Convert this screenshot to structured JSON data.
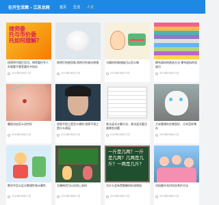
{
  "header": {
    "brand": "在开生活窝 - 江苏龙网",
    "nav": [
      {
        "label": "首页",
        "active": false
      },
      {
        "label": "生活",
        "active": false
      },
      {
        "label": "人文",
        "active": true
      }
    ]
  },
  "cards": [
    {
      "title": "找律师代理打官司，律师委托专人办理要不要签委托书协议",
      "date": "2024年06月17日",
      "thumb": {
        "kind": "text-overlay",
        "text": "律师委\n托与市价委\n托如何理解？",
        "bg": "#f4b400"
      }
    },
    {
      "title": "照明灯的使用和 照明灯的调光原理",
      "date": "2024年06月17日",
      "thumb": {
        "kind": "powder",
        "bg": "#dfe6ec"
      }
    },
    {
      "title": "马桶的防臭措施可以怎么做",
      "date": "2024年06月17日",
      "thumb": {
        "kind": "cartoon",
        "bg": "#f6f0dc"
      }
    },
    {
      "title": "棉布面料的挑选方法 棉布面料的优缺点",
      "date": "2024年06月17日",
      "thumb": {
        "kind": "fabric",
        "bg": "#e8a0c0"
      }
    },
    {
      "title": "腹股沟疝怎么治疗好",
      "date": "2024年06月17日",
      "thumb": {
        "kind": "skin",
        "bg": "#e9b9a7"
      }
    },
    {
      "title": "屈原不投江是怎么想的 屈原不投江是什么原因",
      "date": "2024年06月17日",
      "thumb": {
        "kind": "portrait",
        "bg": "#2a3d4d"
      }
    },
    {
      "title": "乘法竖式计算方法，乘法竖式要注意哪些问题",
      "date": "2024年06月17日",
      "thumb": {
        "kind": "table",
        "bg": "#f2f2f2"
      }
    },
    {
      "title": "大米要储存在哪里好，大米怎样储存",
      "date": "2024年06月17日",
      "thumb": {
        "kind": "cat",
        "bg": "#8c8c8c"
      }
    },
    {
      "title": "数学中怎么区分数理性和计算性",
      "date": "2024年06月17日",
      "thumb": {
        "kind": "cartoon2",
        "bg": "#d9edf8"
      }
    },
    {
      "title": "主播带货可以在网上卖吗",
      "date": "2024年06月17日",
      "thumb": {
        "kind": "classroom",
        "bg": "#3a5a3a"
      }
    },
    {
      "title": "为什么会有黑眼圈的形成原因",
      "date": "2024年06月17日",
      "thumb": {
        "kind": "blackboard",
        "bg": "#1f4f2f",
        "text": "一斤是几两？一斤是几两？几两是几斤？一两是几斤？"
      }
    },
    {
      "title": "洋桔梗开花时间及养护方法",
      "date": "2024年06月17日",
      "thumb": {
        "kind": "children",
        "bg": "#6fa4c8"
      }
    }
  ]
}
